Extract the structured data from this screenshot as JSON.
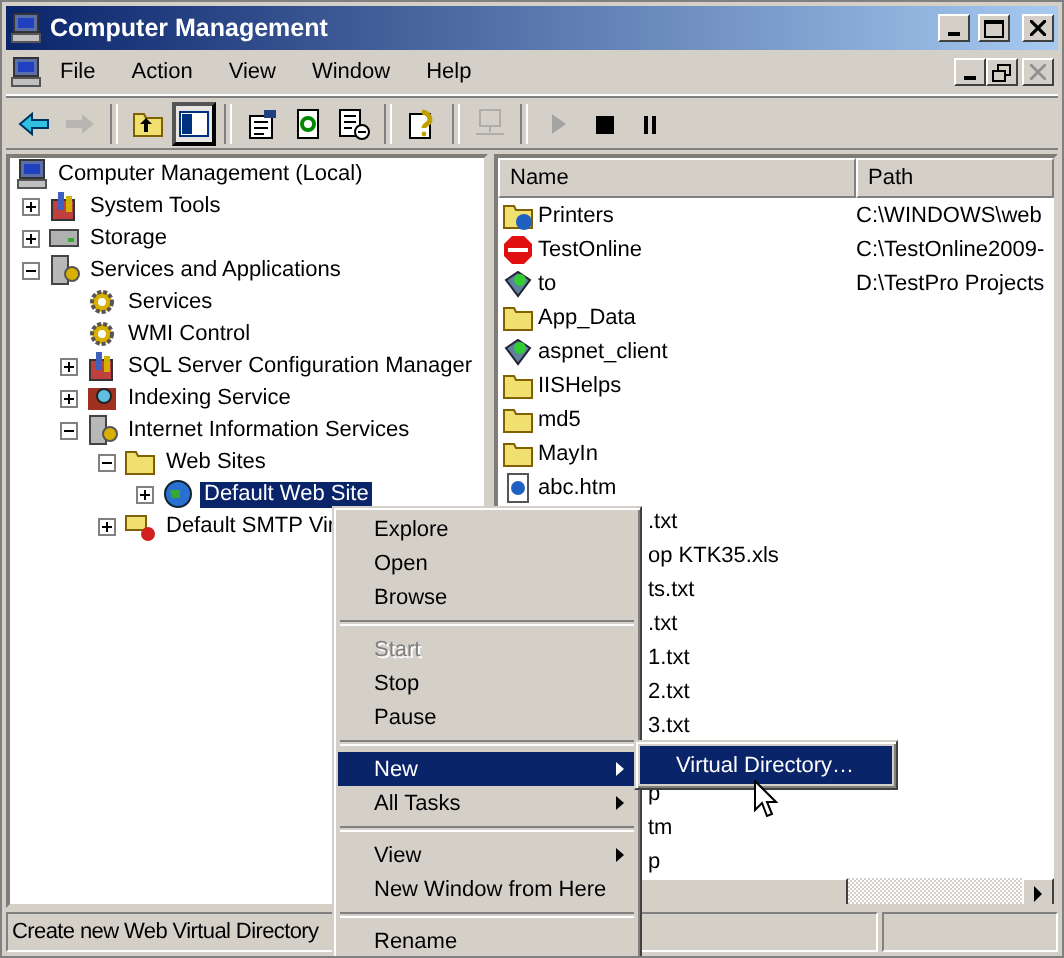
{
  "window": {
    "title": "Computer Management"
  },
  "menu_bar": [
    "File",
    "Action",
    "View",
    "Window",
    "Help"
  ],
  "toolbar": [
    {
      "kind": "back",
      "disabled": false,
      "pressed": false
    },
    {
      "kind": "forward",
      "disabled": true,
      "pressed": false
    },
    {
      "kind": "separator"
    },
    {
      "kind": "up",
      "disabled": false,
      "pressed": false
    },
    {
      "kind": "tree",
      "disabled": false,
      "pressed": true
    },
    {
      "kind": "separator"
    },
    {
      "kind": "properties",
      "disabled": false,
      "pressed": false
    },
    {
      "kind": "refresh",
      "disabled": false,
      "pressed": false
    },
    {
      "kind": "export",
      "disabled": false,
      "pressed": false
    },
    {
      "kind": "separator"
    },
    {
      "kind": "help",
      "disabled": false,
      "pressed": false
    },
    {
      "kind": "separator"
    },
    {
      "kind": "connect",
      "disabled": true,
      "pressed": false
    },
    {
      "kind": "separator"
    },
    {
      "kind": "play",
      "disabled": true,
      "pressed": false
    },
    {
      "kind": "stop",
      "disabled": false,
      "pressed": false
    },
    {
      "kind": "pause",
      "disabled": false,
      "pressed": false
    }
  ],
  "tree": [
    {
      "label": "Computer Management (Local)",
      "kind": "computer",
      "selected": false,
      "children": [
        {
          "label": "System Tools",
          "kind": "toolbox",
          "expanded": false,
          "selected": false
        },
        {
          "label": "Storage",
          "kind": "drive",
          "expanded": false,
          "selected": false
        },
        {
          "label": "Services and Applications",
          "kind": "server",
          "expanded": true,
          "selected": false,
          "children": [
            {
              "label": "Services",
              "kind": "gear",
              "selected": false
            },
            {
              "label": "WMI Control",
              "kind": "gear",
              "selected": false
            },
            {
              "label": "SQL Server Configuration Manager",
              "kind": "toolbox",
              "expanded": false,
              "selected": false
            },
            {
              "label": "Indexing Service",
              "kind": "search",
              "expanded": false,
              "selected": false
            },
            {
              "label": "Internet Information Services",
              "kind": "server",
              "expanded": true,
              "selected": false,
              "children": [
                {
                  "label": "Web Sites",
                  "kind": "folder",
                  "expanded": true,
                  "selected": false,
                  "children": [
                    {
                      "label": "Default Web Site",
                      "kind": "globe",
                      "expanded": false,
                      "selected": true
                    }
                  ]
                },
                {
                  "label": "Default SMTP Vir",
                  "kind": "mail",
                  "expanded": false,
                  "selected": false
                }
              ]
            }
          ]
        }
      ]
    }
  ],
  "list": {
    "columns": [
      "Name",
      "Path"
    ],
    "rows": [
      {
        "name": "Printers",
        "path": "C:\\WINDOWS\\web",
        "kind": "web-folder"
      },
      {
        "name": "TestOnline",
        "path": "C:\\TestOnline2009-",
        "kind": "error"
      },
      {
        "name": "to",
        "path": "D:\\TestPro Projects",
        "kind": "app"
      },
      {
        "name": "App_Data",
        "kind": "folder"
      },
      {
        "name": "aspnet_client",
        "kind": "app"
      },
      {
        "name": "IISHelps",
        "kind": "folder"
      },
      {
        "name": "md5",
        "kind": "folder"
      },
      {
        "name": "MayIn",
        "kind": "folder"
      },
      {
        "name": "abc.htm",
        "kind": "page"
      },
      {
        "name": ".txt",
        "kind": "partial"
      },
      {
        "name": "op KTK35.xls",
        "kind": "partial"
      },
      {
        "name": "ts.txt",
        "kind": "partial"
      },
      {
        "name": ".txt",
        "kind": "partial"
      },
      {
        "name": "1.txt",
        "kind": "partial"
      },
      {
        "name": "2.txt",
        "kind": "partial"
      },
      {
        "name": "3.txt",
        "kind": "partial"
      },
      {
        "name": "p",
        "kind": "partial"
      },
      {
        "name": "tm",
        "kind": "partial"
      },
      {
        "name": "p",
        "kind": "partial"
      }
    ]
  },
  "context_menu": [
    {
      "label": "Explore",
      "kind": "item",
      "disabled": false,
      "selected": false
    },
    {
      "label": "Open",
      "kind": "item",
      "disabled": false,
      "selected": false
    },
    {
      "label": "Browse",
      "kind": "item",
      "disabled": false,
      "selected": false
    },
    {
      "kind": "separator"
    },
    {
      "label": "Start",
      "kind": "item",
      "disabled": true,
      "selected": false
    },
    {
      "label": "Stop",
      "kind": "item",
      "disabled": false,
      "selected": false
    },
    {
      "label": "Pause",
      "kind": "item",
      "disabled": false,
      "selected": false
    },
    {
      "kind": "separator"
    },
    {
      "label": "New",
      "kind": "submenu",
      "disabled": false,
      "selected": true
    },
    {
      "label": "All Tasks",
      "kind": "submenu",
      "disabled": false,
      "selected": false
    },
    {
      "kind": "separator"
    },
    {
      "label": "View",
      "kind": "submenu",
      "disabled": false,
      "selected": false
    },
    {
      "label": "New Window from Here",
      "kind": "item",
      "disabled": false,
      "selected": false
    },
    {
      "kind": "separator"
    },
    {
      "label": "Rename",
      "kind": "item",
      "disabled": false,
      "selected": false
    }
  ],
  "submenu": [
    {
      "label": "Virtual Directory…",
      "selected": true
    }
  ],
  "status_bar": "Create new Web Virtual Directory"
}
